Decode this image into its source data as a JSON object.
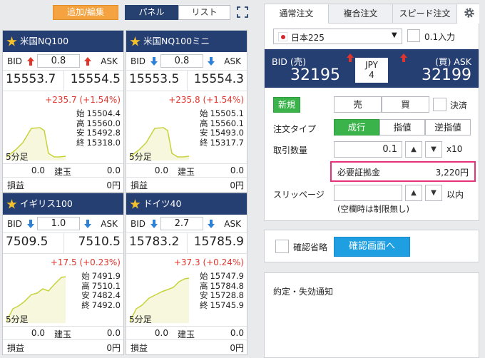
{
  "toolbar": {
    "add_edit": "追加/編集",
    "panel": "パネル",
    "list": "リスト"
  },
  "panels": [
    {
      "name": "米国NQ100",
      "bid_label": "BID",
      "ask_label": "ASK",
      "spread": "0.8",
      "spread_dir": "up",
      "bid": "15553.7",
      "ask": "15554.5",
      "change": "+235.7 (+1.54%)",
      "period": "5分足",
      "open_l": "始",
      "high_l": "高",
      "low_l": "安",
      "close_l": "終",
      "open": "15504.4",
      "high": "15560.0",
      "low": "15492.8",
      "close": "15318.0",
      "pos_left": "0.0",
      "pos_label": "建玉",
      "pos_right": "0.0",
      "pnl_label": "損益",
      "pnl": "0円"
    },
    {
      "name": "米国NQ100ミニ",
      "bid_label": "BID",
      "ask_label": "ASK",
      "spread": "0.8",
      "spread_dir": "down",
      "bid": "15553.5",
      "ask": "15554.3",
      "change": "+235.8 (+1.54%)",
      "period": "5分足",
      "open_l": "始",
      "high_l": "高",
      "low_l": "安",
      "close_l": "終",
      "open": "15505.1",
      "high": "15560.1",
      "low": "15493.0",
      "close": "15317.7",
      "pos_left": "0.0",
      "pos_label": "建玉",
      "pos_right": "0.0",
      "pnl_label": "損益",
      "pnl": "0円"
    },
    {
      "name": "イギリス100",
      "bid_label": "BID",
      "ask_label": "ASK",
      "spread": "1.0",
      "spread_dir": "down",
      "bid": "7509.5",
      "ask": "7510.5",
      "change": "+17.5 (+0.23%)",
      "period": "5分足",
      "open_l": "始",
      "high_l": "高",
      "low_l": "安",
      "close_l": "終",
      "open": "7491.9",
      "high": "7510.1",
      "low": "7482.4",
      "close": "7492.0",
      "pos_left": "0.0",
      "pos_label": "建玉",
      "pos_right": "0.0",
      "pnl_label": "損益",
      "pnl": "0円"
    },
    {
      "name": "ドイツ40",
      "bid_label": "BID",
      "ask_label": "ASK",
      "spread": "2.7",
      "spread_dir": "down",
      "bid": "15783.2",
      "ask": "15785.9",
      "change": "+37.3 (+0.24%)",
      "period": "5分足",
      "open_l": "始",
      "high_l": "高",
      "low_l": "安",
      "close_l": "終",
      "open": "15747.9",
      "high": "15784.8",
      "low": "15728.8",
      "close": "15745.9",
      "pos_left": "0.0",
      "pos_label": "建玉",
      "pos_right": "0.0",
      "pnl_label": "損益",
      "pnl": "0円"
    }
  ],
  "order": {
    "tabs": [
      "通常注文",
      "複合注文",
      "スピード注文"
    ],
    "symbol": "日本225",
    "lot01": "0.1入力",
    "bid_label": "BID (売)",
    "ask_label": "(買) ASK",
    "bid": "32195",
    "ask": "32199",
    "ccy": "JPY",
    "spread": "4",
    "new_label": "新規",
    "sell": "売",
    "buy": "買",
    "settle": "決済",
    "type_label": "注文タイプ",
    "t_market": "成行",
    "t_limit": "指値",
    "t_stop": "逆指値",
    "qty_label": "取引数量",
    "qty": "0.1",
    "qty_unit": "x10",
    "margin_label": "必要証拠金",
    "margin": "3,220円",
    "slip_label": "スリッページ",
    "slip_unit": "以内",
    "slip_note": "(空欄時は制限無し)",
    "skip_confirm": "確認省略",
    "confirm_btn": "確認画面へ"
  },
  "notice": {
    "title": "約定・失効通知"
  },
  "colors": {
    "header": "#263f73",
    "accent": "#f4a340",
    "green": "#3ab34a",
    "cyan": "#1e9fe2",
    "red": "#e0352d",
    "blue": "#2e7fd6",
    "highlight": "#e8317a"
  }
}
